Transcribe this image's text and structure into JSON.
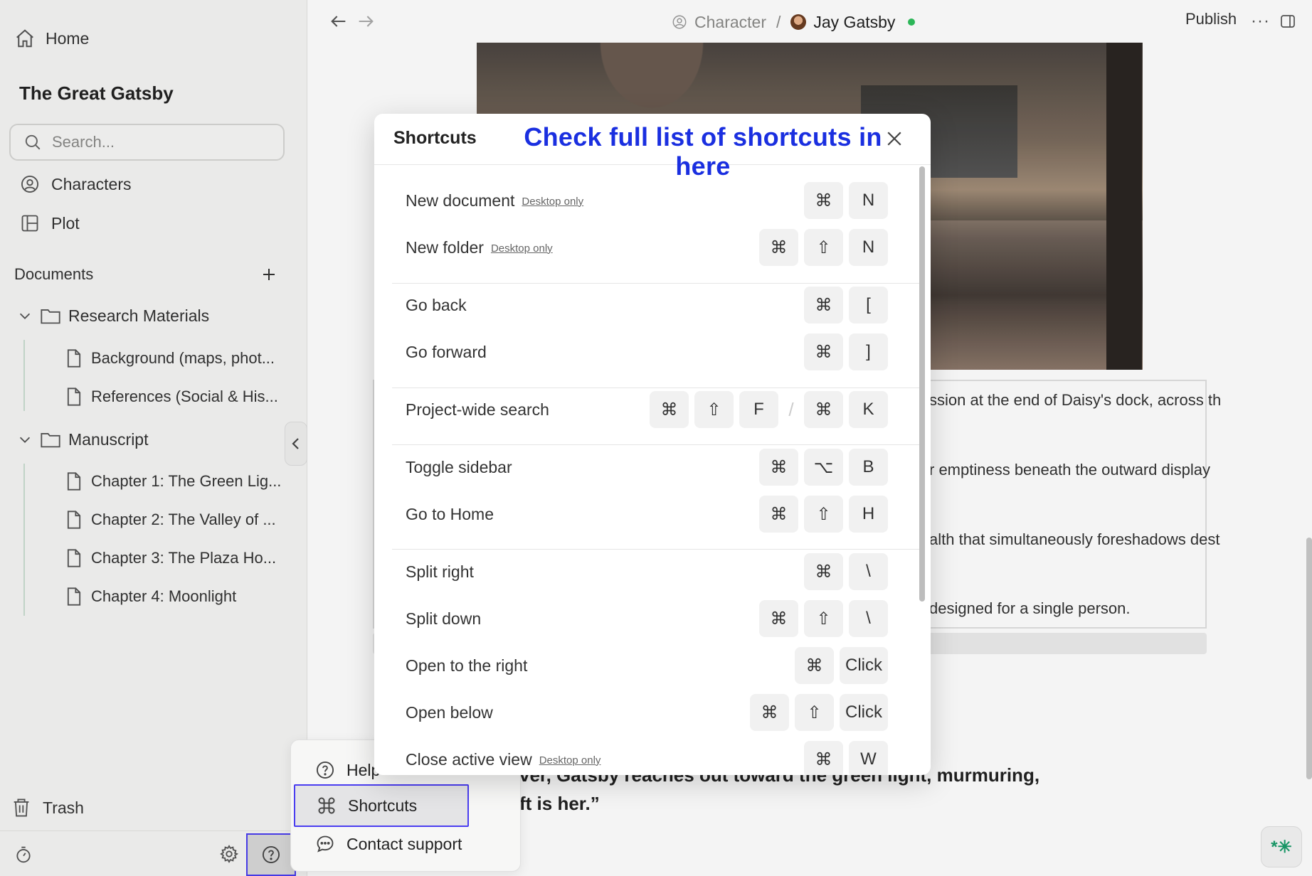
{
  "sidebar": {
    "home_label": "Home",
    "project_title": "The Great Gatsby",
    "search_placeholder": "Search...",
    "characters_label": "Characters",
    "plot_label": "Plot",
    "documents_label": "Documents",
    "folders": [
      {
        "name": "Research Materials",
        "docs": [
          "Background (maps, phot...",
          "References (Social & His..."
        ]
      },
      {
        "name": "Manuscript",
        "docs": [
          "Chapter 1: The Green Lig...",
          "Chapter 2: The Valley of ...",
          "Chapter 3: The Plaza Ho...",
          "Chapter 4: Moonlight"
        ]
      }
    ],
    "trash_label": "Trash"
  },
  "topbar": {
    "breadcrumb_parent": "Character",
    "breadcrumb_separator": "/",
    "breadcrumb_current": "Jay Gatsby",
    "publish_label": "Publish",
    "more_label": "···",
    "status_color": "#2fbf5c"
  },
  "editor": {
    "table_lines": [
      "ssion at the end of Daisy's dock, across th",
      "r emptiness beneath the outward display",
      "alth that simultaneously foreshadows dest",
      "designed for a single person."
    ],
    "quote_line_1": "ver, Gatsby reaches out toward the green light, murmuring,",
    "quote_line_2": "ft is her.”",
    "ai_button_label": "*✳"
  },
  "help_menu": {
    "items": [
      {
        "label": "Help",
        "icon": "help-circle-icon"
      },
      {
        "label": "Shortcuts",
        "icon": "command-icon"
      },
      {
        "label": "Contact support",
        "icon": "chat-bubble-icon"
      }
    ]
  },
  "modal": {
    "title": "Shortcuts",
    "annotation": "Check full list of shortcuts in here",
    "annotation_color": "#1a2fe0",
    "shortcuts": [
      {
        "label": "New document",
        "tag": "Desktop only",
        "keys": [
          "⌘",
          "N"
        ]
      },
      {
        "label": "New folder",
        "tag": "Desktop only",
        "keys": [
          "⌘",
          "⇧",
          "N"
        ]
      },
      {
        "label": "Go back",
        "tag": "",
        "keys": [
          "⌘",
          "["
        ]
      },
      {
        "label": "Go forward",
        "tag": "",
        "keys": [
          "⌘",
          "]"
        ]
      },
      {
        "label": "Project-wide search",
        "tag": "",
        "keys": [
          "⌘",
          "⇧",
          "F",
          "/",
          "⌘",
          "K"
        ]
      },
      {
        "label": "Toggle sidebar",
        "tag": "",
        "keys": [
          "⌘",
          "⌥",
          "B"
        ]
      },
      {
        "label": "Go to Home",
        "tag": "",
        "keys": [
          "⌘",
          "⇧",
          "H"
        ]
      },
      {
        "label": "Split right",
        "tag": "",
        "keys": [
          "⌘",
          "\\"
        ]
      },
      {
        "label": "Split down",
        "tag": "",
        "keys": [
          "⌘",
          "⇧",
          "\\"
        ]
      },
      {
        "label": "Open to the right",
        "tag": "",
        "keys": [
          "⌘",
          "Click"
        ]
      },
      {
        "label": "Open below",
        "tag": "",
        "keys": [
          "⌘",
          "⇧",
          "Click"
        ]
      },
      {
        "label": "Close active view",
        "tag": "Desktop only",
        "keys": [
          "⌘",
          "W"
        ]
      }
    ]
  }
}
